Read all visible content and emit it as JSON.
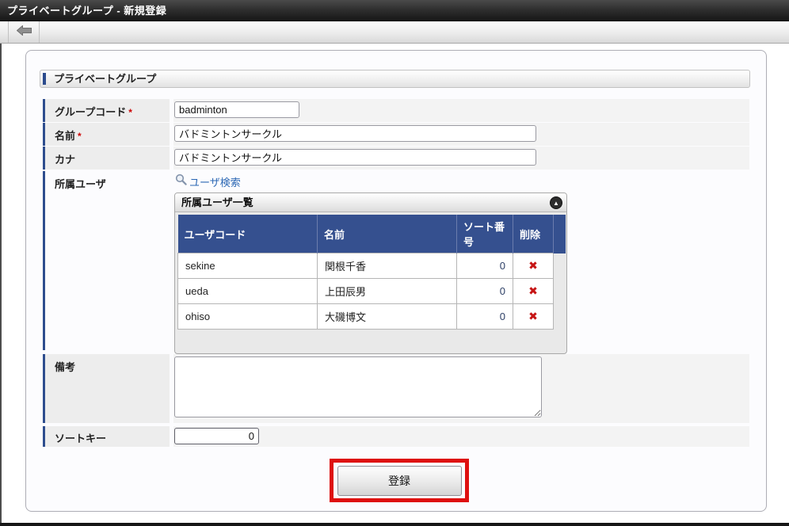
{
  "titlebar": {
    "title": "プライベートグループ - 新規登録"
  },
  "toolbar": {
    "back_icon": "arrow-left"
  },
  "form": {
    "section_title": "プライベートグループ",
    "required_mark": "*",
    "group_code": {
      "label": "グループコード",
      "value": "badminton"
    },
    "name": {
      "label": "名前",
      "value": "バドミントンサークル"
    },
    "kana": {
      "label": "カナ",
      "value": "バドミントンサークル"
    },
    "members": {
      "label": "所属ユーザ",
      "search_link": "ユーザ検索",
      "panel_title": "所属ユーザ一覧",
      "table": {
        "headers": [
          "ユーザコード",
          "名前",
          "ソート番号",
          "削除"
        ],
        "rows": [
          {
            "user_code": "sekine",
            "name": "関根千香",
            "sort": "0"
          },
          {
            "user_code": "ueda",
            "name": "上田辰男",
            "sort": "0"
          },
          {
            "user_code": "ohiso",
            "name": "大磯博文",
            "sort": "0"
          }
        ]
      }
    },
    "remarks": {
      "label": "備考",
      "value": ""
    },
    "sort_key": {
      "label": "ソートキー",
      "value": "0"
    },
    "submit_label": "登録"
  },
  "icons": {
    "delete": "✖",
    "collapse": "▲"
  },
  "colors": {
    "table_header_blue": "#35508f",
    "accent_bar_blue": "#2e4d8e",
    "link_blue": "#2b67b4",
    "required_red": "#cc0000",
    "delete_red": "#c61414",
    "highlight_red": "#de1010"
  }
}
